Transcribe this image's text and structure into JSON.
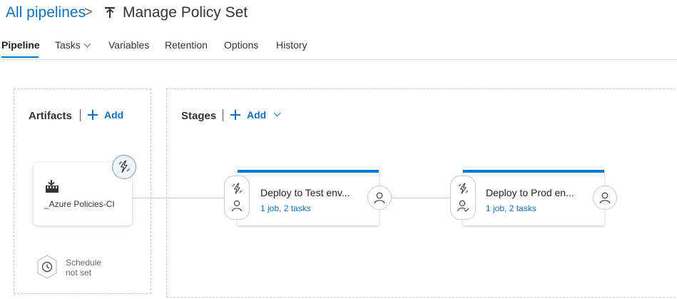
{
  "header": {
    "breadcrumb_link": "All pipelines",
    "breadcrumb_separator": ">",
    "title": "Manage Policy Set"
  },
  "tabs": [
    {
      "label": "Pipeline",
      "active": true
    },
    {
      "label": "Tasks"
    },
    {
      "label": "Variables"
    },
    {
      "label": "Retention"
    },
    {
      "label": "Options"
    },
    {
      "label": "History"
    }
  ],
  "artifacts": {
    "title": "Artifacts",
    "add_label": "Add",
    "items": [
      {
        "name": "_Azure Policies-CI",
        "icon": "build-artifact-icon",
        "trigger_icon": "lightning-icon"
      }
    ],
    "schedule": {
      "line1": "Schedule",
      "line2": "not set",
      "icon": "clock-icon"
    }
  },
  "stages": {
    "title": "Stages",
    "add_label": "Add",
    "items": [
      {
        "name": "Deploy to Test env...",
        "summary": "1 job, 2 tasks"
      },
      {
        "name": "Deploy to Prod en...",
        "summary": "1 job, 2 tasks"
      }
    ]
  },
  "colors": {
    "accent": "#0078d4",
    "link": "#106ebe",
    "border": "#c8c8c8"
  }
}
